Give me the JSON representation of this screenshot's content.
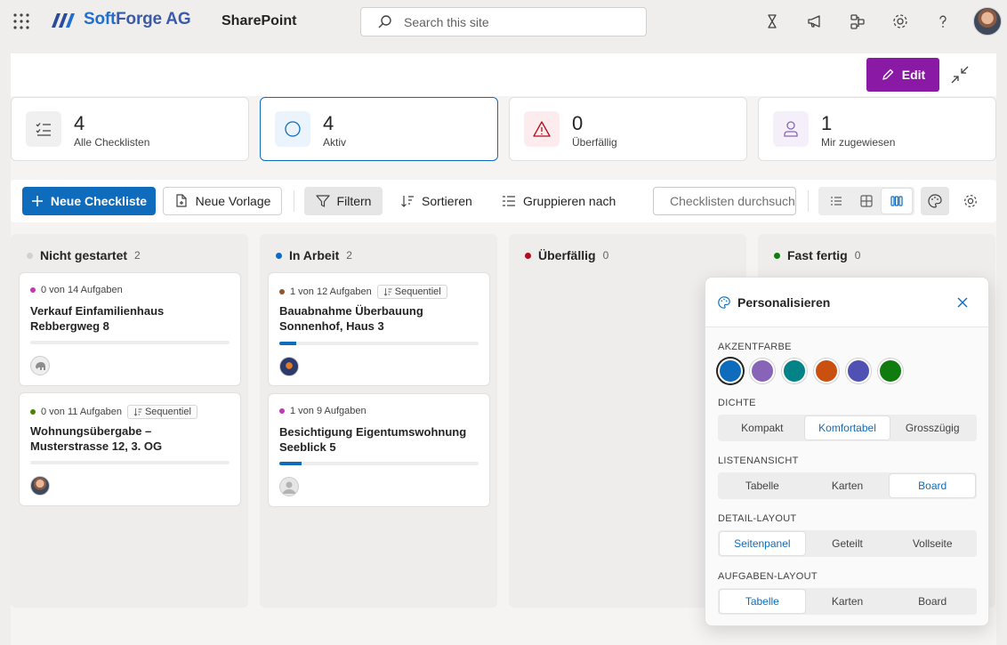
{
  "brand": {
    "name_prefix": "Soft",
    "name_suffix": "Forge AG",
    "app": "SharePoint"
  },
  "top_search": {
    "placeholder": "Search this site"
  },
  "top_icons": [
    "copilot-icon",
    "megaphone-icon",
    "share-icon",
    "gear-icon",
    "help-icon"
  ],
  "command_bar": {
    "edit_label": "Edit"
  },
  "stats": [
    {
      "value": "4",
      "label": "Alle Checklisten"
    },
    {
      "value": "4",
      "label": "Aktiv"
    },
    {
      "value": "0",
      "label": "Überfällig"
    },
    {
      "value": "1",
      "label": "Mir zugewiesen"
    }
  ],
  "toolbar": {
    "new_checklist": "Neue Checkliste",
    "new_template": "Neue Vorlage",
    "filter": "Filtern",
    "sort": "Sortieren",
    "group": "Gruppieren nach",
    "search_placeholder": "Checklisten durchsuchen"
  },
  "columns": [
    {
      "title": "Nicht gestartet",
      "count": "2",
      "dot": "#d1d1d1"
    },
    {
      "title": "In Arbeit",
      "count": "2",
      "dot": "#0f6cbd"
    },
    {
      "title": "Überfällig",
      "count": "0",
      "dot": "#b10e1c"
    },
    {
      "title": "Fast fertig",
      "count": "0",
      "dot": "#107c10"
    }
  ],
  "cards": [
    {
      "meta": "0 von 14 Aufgaben",
      "badge": "",
      "title": "Verkauf Einfamilienhaus Rebbergweg 8",
      "progress": 0,
      "dot": "#c239b3"
    },
    {
      "meta": "0 von 11 Aufgaben",
      "badge": "Sequentiel",
      "title": "Wohnungsübergabe – Musterstrasse 12, 3. OG",
      "progress": 0,
      "dot": "#498205"
    },
    {
      "meta": "1 von 12 Aufgaben",
      "badge": "Sequentiel",
      "title": "Bauabnahme Überbauung Sonnenhof, Haus 3",
      "progress": 0.0833,
      "dot": "#8e562e"
    },
    {
      "meta": "1 von 9 Aufgaben",
      "badge": "",
      "title": "Besichtigung Eigentumswohnung Seeblick 5",
      "progress": 0.1111,
      "dot": "#c239b3"
    }
  ],
  "panel": {
    "title": "Personalisieren",
    "accent_label": "AKZENTFARBE",
    "accent_colors": [
      "#0f6cbd",
      "#8764b8",
      "#038387",
      "#ca5010",
      "#4f52b2",
      "#107c10"
    ],
    "density_label": "DICHTE",
    "density_options": [
      "Kompakt",
      "Komfortabel",
      "Grosszügig"
    ],
    "list_label": "LISTENANSICHT",
    "list_options": [
      "Tabelle",
      "Karten",
      "Board"
    ],
    "detail_label": "DETAIL-LAYOUT",
    "detail_options": [
      "Seitenpanel",
      "Geteilt",
      "Vollseite"
    ],
    "task_label": "AUFGABEN-LAYOUT",
    "task_options": [
      "Tabelle",
      "Karten",
      "Board"
    ]
  }
}
